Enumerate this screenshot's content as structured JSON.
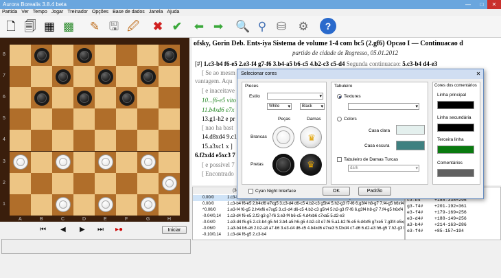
{
  "window": {
    "title": "Aurora Borealis 3.8.4 beta"
  },
  "menu": [
    "Partida",
    "Ver",
    "Tempo",
    "Jogar",
    "Treinador",
    "Opções",
    "Base de dados",
    "Janela",
    "Ajuda"
  ],
  "toolbar_icons": [
    "new-icon",
    "open-icon",
    "board-icon",
    "color-board-icon",
    "edit-icon",
    "save-icon",
    "save-as-icon",
    "delete-icon",
    "confirm-icon",
    "back-icon",
    "forward-icon",
    "search-icon",
    "find-icon",
    "database-icon",
    "settings-icon",
    "help-icon"
  ],
  "board": {
    "ranks": [
      "8",
      "7",
      "6",
      "5",
      "4",
      "3",
      "2",
      "1"
    ],
    "files": [
      "A",
      "B",
      "C",
      "D",
      "E",
      "F",
      "G",
      "H"
    ],
    "pieces": [
      {
        "sq": "b8",
        "c": "b"
      },
      {
        "sq": "d8",
        "c": "b"
      },
      {
        "sq": "h8",
        "c": "b"
      },
      {
        "sq": "c7",
        "c": "b"
      },
      {
        "sq": "e7",
        "c": "b"
      },
      {
        "sq": "g7",
        "c": "b"
      },
      {
        "sq": "b6",
        "c": "b"
      },
      {
        "sq": "d6",
        "c": "b"
      },
      {
        "sq": "f6",
        "c": "b"
      },
      {
        "sq": "a3",
        "c": "w"
      },
      {
        "sq": "c3",
        "c": "w"
      },
      {
        "sq": "e3",
        "c": "w"
      },
      {
        "sq": "g3",
        "c": "w"
      },
      {
        "sq": "h2",
        "c": "w"
      },
      {
        "sq": "c1",
        "c": "w"
      },
      {
        "sq": "e1",
        "c": "w"
      },
      {
        "sq": "g1",
        "c": "w"
      }
    ]
  },
  "nav": {
    "first": "⏮",
    "prev": "◀",
    "next": "▶",
    "last": "⏭",
    "start_label": "Iniciar"
  },
  "notation": {
    "heading": "ofsky, Gorin Deb. Ents-iya Sistema de volume 1-4 com bc5 (2.gf6) Opcao I — Continuacao d",
    "subtitle": "partido de cidade de Regresso, 05.01.2012",
    "line1_tag": "[#]",
    "line1_moves": "1.c3-b4 f6-e5 2.e3-f4 g7-f6 3.b4-a5 b6-c5 4.b2-c3 c5-d4",
    "line1_comment": "Segunda continuacao:",
    "line1_tail": "5.c3-b4 d4-e3",
    "l2": "[ Se ao mesm",
    "l3": "vantagem. Aqu",
    "l4": "[ e inaceitave",
    "l5": "10...f6-e5 vito",
    "l6": "11.b4xd6 e7x",
    "l7": "13.g1-h2 e pr",
    "l8": "[ nao ha bast",
    "l9": "14.d8xd4 9.c1-d",
    "l10": "15.a3xc1 x ]",
    "l11": "6.f2xd4 e5xc3 7",
    "l12": "[ e possivel 7",
    "l13": "[ Encontrado"
  },
  "engine": {
    "header": "(38)Au",
    "rows": [
      {
        "score": "0.00/0",
        "pv": "1.c3-b4 f6-e5 2.g3-h4 b6-c5 3.b4-a5 c7-b6 4.e3-d4 e5xc3 5.b2xd4 g7-f6 6.d4xb6 a7xc5 7.a5xc7 d8xb6"
      },
      {
        "score": "0.00/0",
        "pv": "1.c3-b4 f6-e5 2.h4xf6 e7xg5 3.c3-d4 d6-c5 4.b2-c3 g5h4 5.h2-g3 f7-f6 6.g3f4 h8-g7 7.f4-g5 h6xf4 8.e"
      },
      {
        "score": "^0.00/0",
        "pv": "1.e3-f4 f6-g5 2.h4xf6 e7xg5 3.c3-d4 d6-c5 4.b2-c3 g5h4 5.h2-g3 f7-f6 6.g3f4 h8-g7 7.f4-g5 h6xf4 8.e"
      },
      {
        "score": "-0.04/0,14",
        "pv": "1.c3-d4 f6-e5 2.f2-g3 g7-f6 3.e3-f4 b6-c5 4.d4xb6 c7xa5 5.d2-e3"
      },
      {
        "score": "-0.04/0",
        "pv": "1.e3-d4 f6-g5 2.c3-b4 g5-h4 3.b4-a5 h6-g5 4.b2-c3 e7-f6 5.a1-b2 f6-e5 6.d4xf6 g7xe5 7.g3f4 e5xg3"
      },
      {
        "score": "-0.06/0",
        "pv": "1.a3-b4 b6-a5 2.b2-a3 a7-b6 3.e3-d4 d6-c5 4.b4xd6 e7xe3 5.f2xd4 c7-d6 6.d2-e3 h6-g5 7.h2-g3 f6-e5"
      },
      {
        "score": "-0.10/0,14",
        "pv": "1.c3-d4 f6-g5 2.c3-b4"
      }
    ]
  },
  "sidelist": [
    {
      "mv": "c3-b4",
      "ev": "+188-338=296"
    },
    {
      "mv": "g3-f4#",
      "ev": "+201-192=361"
    },
    {
      "mv": "e3-f4#",
      "ev": "+179-169=256"
    },
    {
      "mv": "e3-d4#",
      "ev": "+188-149=256"
    },
    {
      "mv": "a3-b4#",
      "ev": "+214-163=286"
    },
    {
      "mv": "e3-f4#",
      "ev": "+85-157=194"
    }
  ],
  "dialog": {
    "title": "Selecionar cores",
    "pieces_group": "Pieces",
    "style_label": "Estilo",
    "white_sel": "White",
    "black_sel": "Black",
    "col_pieces": "Peças",
    "col_kings": "Damas",
    "row_white": "Brancas",
    "row_black": "Pretas",
    "board_group": "Tabuleiro",
    "textures_label": "Textures",
    "colors_label": "Colors",
    "light_label": "Casa clara",
    "dark_label": "Casa escura",
    "turkish_label": "Tabuleiro de Damas Turcas",
    "turkish_sel": "dark",
    "comments_group": "Cores dos comentários",
    "main_line": "Linha principal",
    "second_line": "Linha secundária",
    "third_line": "Terceira linha",
    "comments": "Comentários",
    "cyan_label": "Cyan Night Interface",
    "ok": "OK",
    "default": "Padrão",
    "colors": {
      "light": "#e4f0ee",
      "dark": "#3e8080",
      "main": "#000000",
      "second": "#000000",
      "third": "#0a7a10",
      "comm": "#606060"
    }
  }
}
